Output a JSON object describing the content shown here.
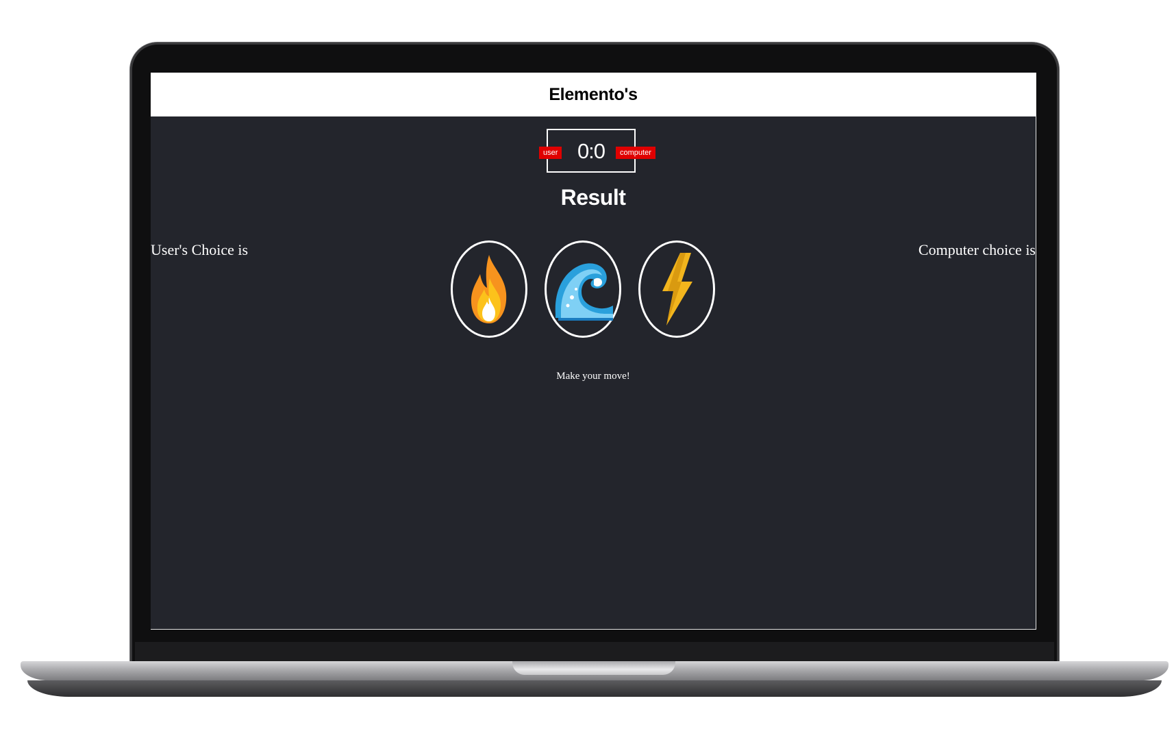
{
  "app": {
    "title": "Elemento's"
  },
  "scoreboard": {
    "score": "0:0",
    "user_badge": "user",
    "computer_badge": "computer"
  },
  "result": {
    "heading": "Result"
  },
  "labels": {
    "user_choice": "User's Choice is",
    "computer_choice": "Computer choice is"
  },
  "choices": [
    {
      "name": "fire",
      "icon": "fire-icon"
    },
    {
      "name": "water",
      "icon": "wave-icon"
    },
    {
      "name": "lightning",
      "icon": "lightning-icon"
    }
  ],
  "status": {
    "message": "Make your move!"
  },
  "colors": {
    "background": "#23252c",
    "badge": "#e00000",
    "accent": "#ffffff"
  }
}
